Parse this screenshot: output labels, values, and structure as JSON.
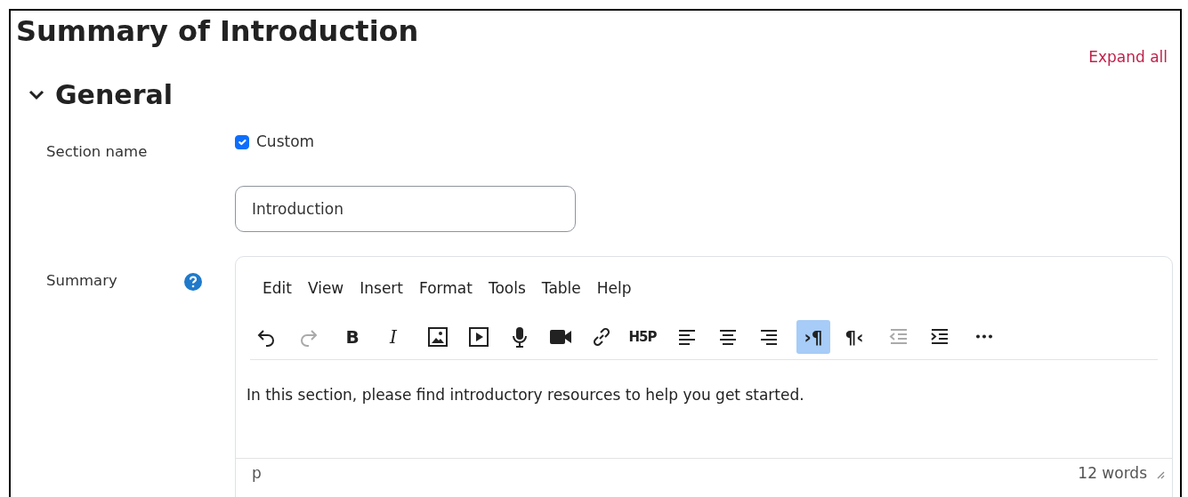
{
  "title": "Summary of Introduction",
  "expand_all": "Expand all",
  "section": {
    "title": "General",
    "expanded": true
  },
  "section_name": {
    "label": "Section name",
    "custom": {
      "label": "Custom",
      "checked": true
    },
    "value": "Introduction"
  },
  "summary": {
    "label": "Summary",
    "menu": [
      "Edit",
      "View",
      "Insert",
      "Format",
      "Tools",
      "Table",
      "Help"
    ],
    "toolbar": [
      [
        {
          "kind": "undo",
          "disabled": false,
          "selected": false
        },
        {
          "kind": "redo",
          "disabled": true,
          "selected": false
        }
      ],
      [
        {
          "kind": "bold-letter",
          "label": "B",
          "disabled": false,
          "selected": false
        },
        {
          "kind": "italic-letter",
          "label": "I",
          "disabled": false,
          "selected": false
        }
      ],
      [
        {
          "kind": "image",
          "disabled": false,
          "selected": false
        },
        {
          "kind": "media",
          "disabled": false,
          "selected": false
        },
        {
          "kind": "microphone",
          "disabled": false,
          "selected": false
        },
        {
          "kind": "camera",
          "disabled": false,
          "selected": false
        },
        {
          "kind": "link",
          "disabled": false,
          "selected": false
        },
        {
          "kind": "logo-text",
          "label": "H5P",
          "disabled": false,
          "selected": false
        }
      ],
      [
        {
          "kind": "align-left",
          "disabled": false,
          "selected": false
        },
        {
          "kind": "align-center",
          "disabled": false,
          "selected": false
        },
        {
          "kind": "align-right",
          "disabled": false,
          "selected": false
        }
      ],
      [
        {
          "kind": "bold-letter",
          "label": "›¶",
          "disabled": false,
          "selected": true
        },
        {
          "kind": "bold-letter",
          "label": "¶‹",
          "disabled": false,
          "selected": false
        }
      ],
      [
        {
          "kind": "outdent",
          "disabled": true,
          "selected": false
        },
        {
          "kind": "indent",
          "disabled": false,
          "selected": false
        }
      ],
      [
        {
          "kind": "more",
          "disabled": false,
          "selected": false
        }
      ]
    ],
    "content": "In this section, please find introductory resources to help you get started.",
    "path": "p",
    "word_count": "12 words"
  }
}
